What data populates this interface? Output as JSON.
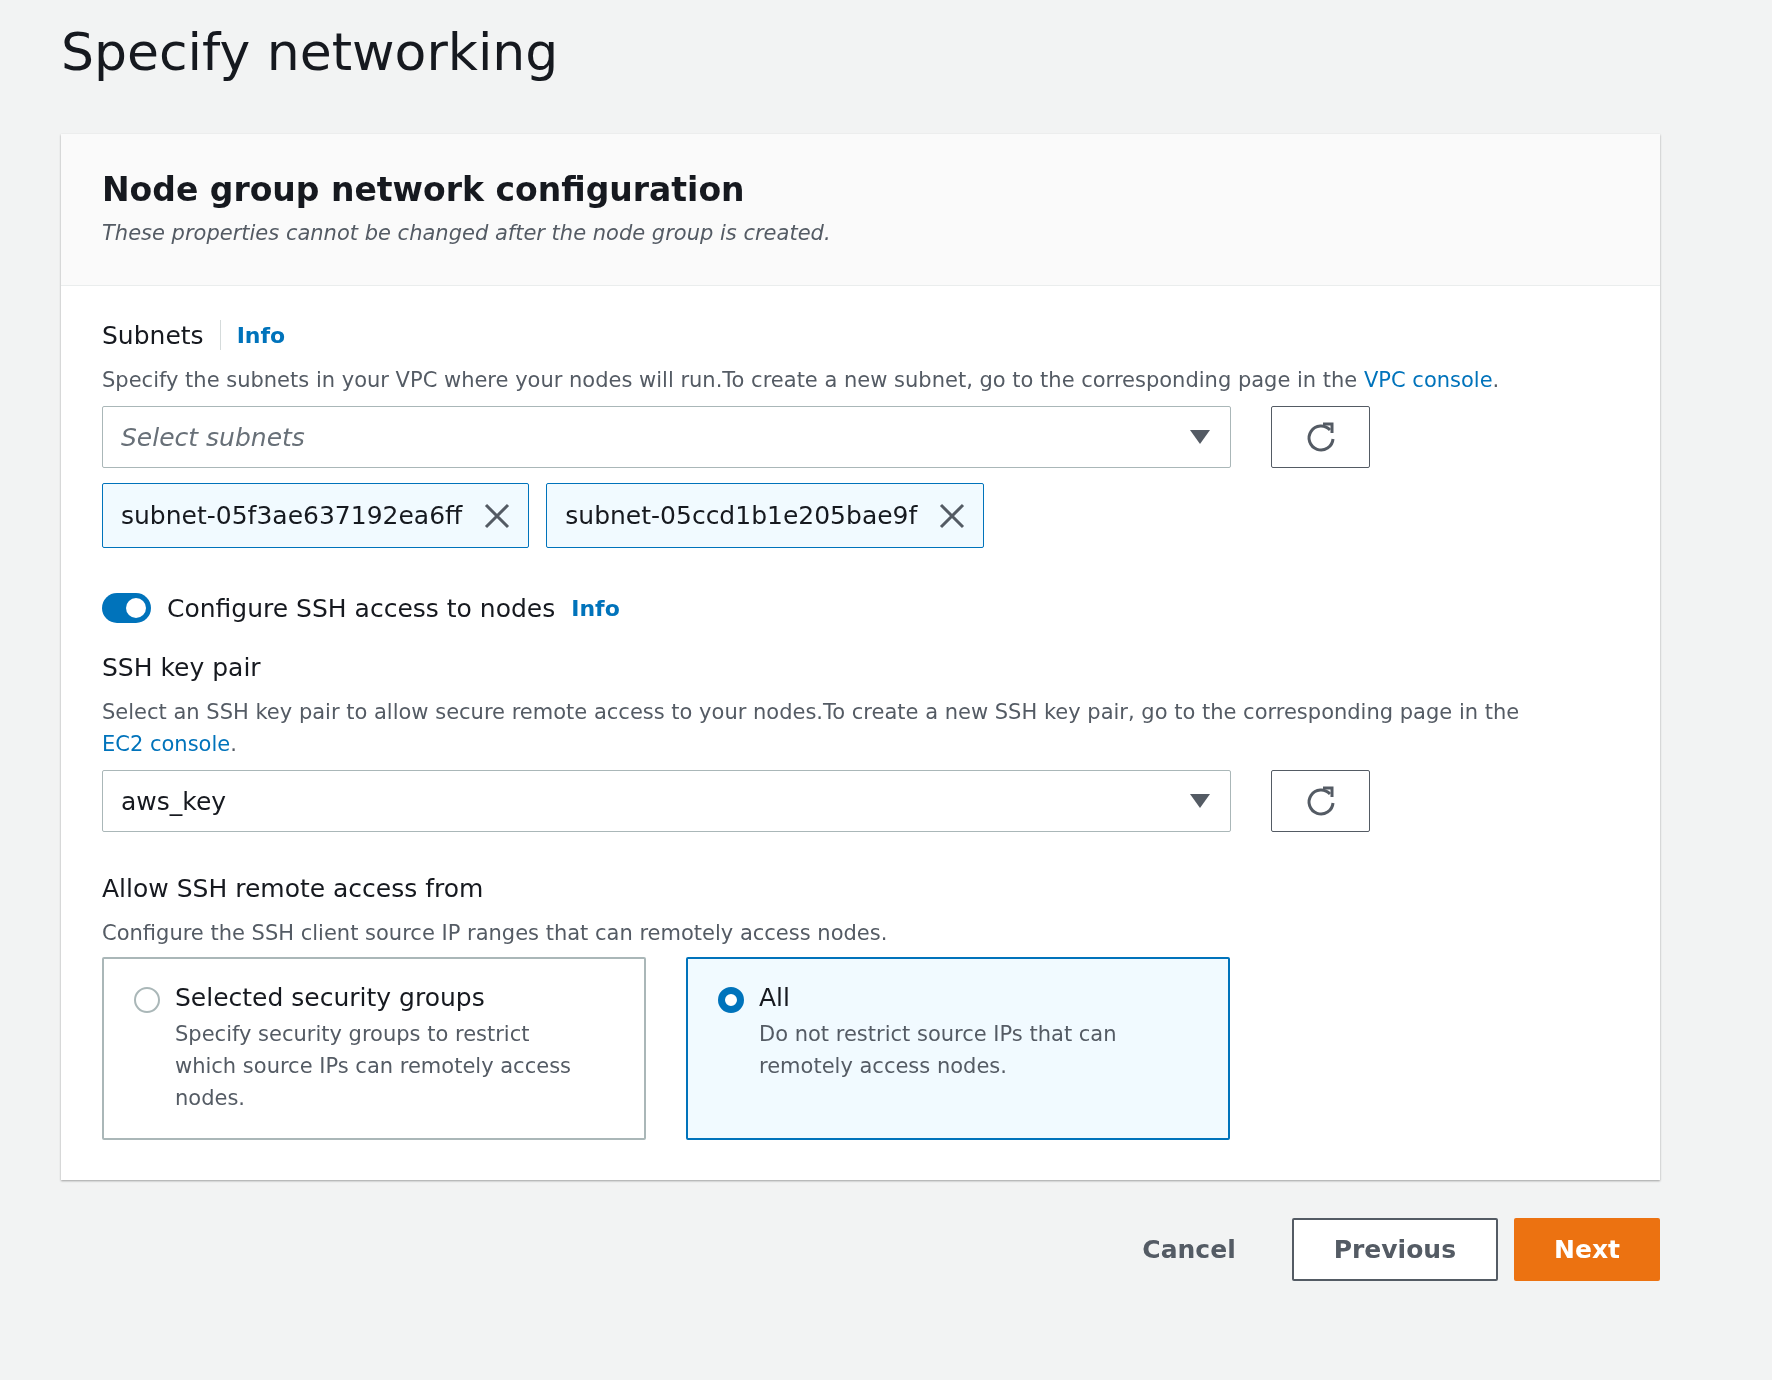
{
  "page_title": "Specify networking",
  "panel": {
    "title": "Node group network configuration",
    "subtitle": "These properties cannot be changed after the node group is created."
  },
  "subnets": {
    "label": "Subnets",
    "info": "Info",
    "description": "Specify the subnets in your VPC where your nodes will run.To create a new subnet, go to the corresponding page in the ",
    "link": "VPC console",
    "description_end": ".",
    "select": {
      "placeholder": "Select subnets"
    },
    "tokens": [
      {
        "label": "subnet-05f3ae637192ea6ff"
      },
      {
        "label": "subnet-05ccd1b1e205bae9f"
      }
    ]
  },
  "ssh_toggle": {
    "label": "Configure SSH access to nodes",
    "info": "Info",
    "on": true
  },
  "key_pair": {
    "label": "SSH key pair",
    "description": "Select an SSH key pair to allow secure remote access to your nodes.To create a new SSH key pair, go to the corresponding page in the ",
    "link": "EC2 console",
    "description_end": ".",
    "select": {
      "value": "aws_key"
    }
  },
  "remote_access": {
    "label": "Allow SSH remote access from",
    "description": "Configure the SSH client source IP ranges that can remotely access nodes.",
    "options": [
      {
        "title": "Selected security groups",
        "description": "Specify security groups to restrict which source IPs can remotely access nodes.",
        "selected": false
      },
      {
        "title": "All",
        "description": "Do not restrict source IPs that can remotely access nodes.",
        "selected": true
      }
    ]
  },
  "buttons": [
    {
      "label": "Cancel",
      "kind": "link"
    },
    {
      "label": "Previous",
      "kind": "secondary"
    },
    {
      "label": "Next",
      "kind": "primary"
    }
  ]
}
